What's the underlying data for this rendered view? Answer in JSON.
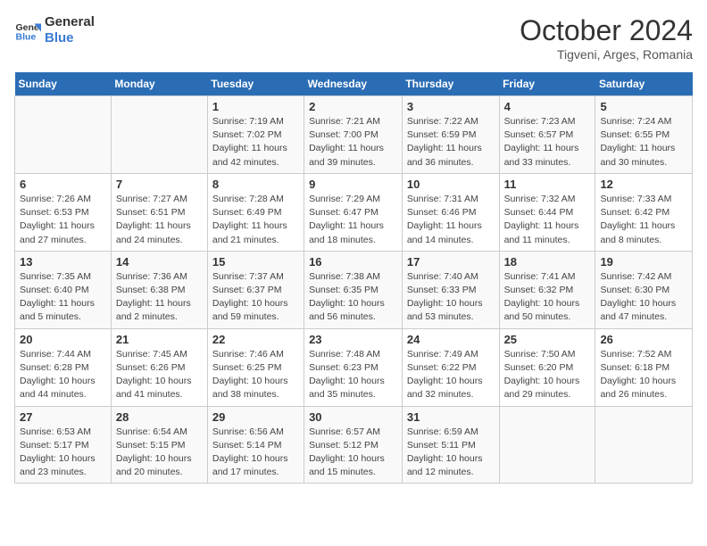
{
  "header": {
    "logo_line1": "General",
    "logo_line2": "Blue",
    "month": "October 2024",
    "location": "Tigveni, Arges, Romania"
  },
  "weekdays": [
    "Sunday",
    "Monday",
    "Tuesday",
    "Wednesday",
    "Thursday",
    "Friday",
    "Saturday"
  ],
  "weeks": [
    [
      {
        "day": "",
        "info": ""
      },
      {
        "day": "",
        "info": ""
      },
      {
        "day": "1",
        "info": "Sunrise: 7:19 AM\nSunset: 7:02 PM\nDaylight: 11 hours and 42 minutes."
      },
      {
        "day": "2",
        "info": "Sunrise: 7:21 AM\nSunset: 7:00 PM\nDaylight: 11 hours and 39 minutes."
      },
      {
        "day": "3",
        "info": "Sunrise: 7:22 AM\nSunset: 6:59 PM\nDaylight: 11 hours and 36 minutes."
      },
      {
        "day": "4",
        "info": "Sunrise: 7:23 AM\nSunset: 6:57 PM\nDaylight: 11 hours and 33 minutes."
      },
      {
        "day": "5",
        "info": "Sunrise: 7:24 AM\nSunset: 6:55 PM\nDaylight: 11 hours and 30 minutes."
      }
    ],
    [
      {
        "day": "6",
        "info": "Sunrise: 7:26 AM\nSunset: 6:53 PM\nDaylight: 11 hours and 27 minutes."
      },
      {
        "day": "7",
        "info": "Sunrise: 7:27 AM\nSunset: 6:51 PM\nDaylight: 11 hours and 24 minutes."
      },
      {
        "day": "8",
        "info": "Sunrise: 7:28 AM\nSunset: 6:49 PM\nDaylight: 11 hours and 21 minutes."
      },
      {
        "day": "9",
        "info": "Sunrise: 7:29 AM\nSunset: 6:47 PM\nDaylight: 11 hours and 18 minutes."
      },
      {
        "day": "10",
        "info": "Sunrise: 7:31 AM\nSunset: 6:46 PM\nDaylight: 11 hours and 14 minutes."
      },
      {
        "day": "11",
        "info": "Sunrise: 7:32 AM\nSunset: 6:44 PM\nDaylight: 11 hours and 11 minutes."
      },
      {
        "day": "12",
        "info": "Sunrise: 7:33 AM\nSunset: 6:42 PM\nDaylight: 11 hours and 8 minutes."
      }
    ],
    [
      {
        "day": "13",
        "info": "Sunrise: 7:35 AM\nSunset: 6:40 PM\nDaylight: 11 hours and 5 minutes."
      },
      {
        "day": "14",
        "info": "Sunrise: 7:36 AM\nSunset: 6:38 PM\nDaylight: 11 hours and 2 minutes."
      },
      {
        "day": "15",
        "info": "Sunrise: 7:37 AM\nSunset: 6:37 PM\nDaylight: 10 hours and 59 minutes."
      },
      {
        "day": "16",
        "info": "Sunrise: 7:38 AM\nSunset: 6:35 PM\nDaylight: 10 hours and 56 minutes."
      },
      {
        "day": "17",
        "info": "Sunrise: 7:40 AM\nSunset: 6:33 PM\nDaylight: 10 hours and 53 minutes."
      },
      {
        "day": "18",
        "info": "Sunrise: 7:41 AM\nSunset: 6:32 PM\nDaylight: 10 hours and 50 minutes."
      },
      {
        "day": "19",
        "info": "Sunrise: 7:42 AM\nSunset: 6:30 PM\nDaylight: 10 hours and 47 minutes."
      }
    ],
    [
      {
        "day": "20",
        "info": "Sunrise: 7:44 AM\nSunset: 6:28 PM\nDaylight: 10 hours and 44 minutes."
      },
      {
        "day": "21",
        "info": "Sunrise: 7:45 AM\nSunset: 6:26 PM\nDaylight: 10 hours and 41 minutes."
      },
      {
        "day": "22",
        "info": "Sunrise: 7:46 AM\nSunset: 6:25 PM\nDaylight: 10 hours and 38 minutes."
      },
      {
        "day": "23",
        "info": "Sunrise: 7:48 AM\nSunset: 6:23 PM\nDaylight: 10 hours and 35 minutes."
      },
      {
        "day": "24",
        "info": "Sunrise: 7:49 AM\nSunset: 6:22 PM\nDaylight: 10 hours and 32 minutes."
      },
      {
        "day": "25",
        "info": "Sunrise: 7:50 AM\nSunset: 6:20 PM\nDaylight: 10 hours and 29 minutes."
      },
      {
        "day": "26",
        "info": "Sunrise: 7:52 AM\nSunset: 6:18 PM\nDaylight: 10 hours and 26 minutes."
      }
    ],
    [
      {
        "day": "27",
        "info": "Sunrise: 6:53 AM\nSunset: 5:17 PM\nDaylight: 10 hours and 23 minutes."
      },
      {
        "day": "28",
        "info": "Sunrise: 6:54 AM\nSunset: 5:15 PM\nDaylight: 10 hours and 20 minutes."
      },
      {
        "day": "29",
        "info": "Sunrise: 6:56 AM\nSunset: 5:14 PM\nDaylight: 10 hours and 17 minutes."
      },
      {
        "day": "30",
        "info": "Sunrise: 6:57 AM\nSunset: 5:12 PM\nDaylight: 10 hours and 15 minutes."
      },
      {
        "day": "31",
        "info": "Sunrise: 6:59 AM\nSunset: 5:11 PM\nDaylight: 10 hours and 12 minutes."
      },
      {
        "day": "",
        "info": ""
      },
      {
        "day": "",
        "info": ""
      }
    ]
  ]
}
